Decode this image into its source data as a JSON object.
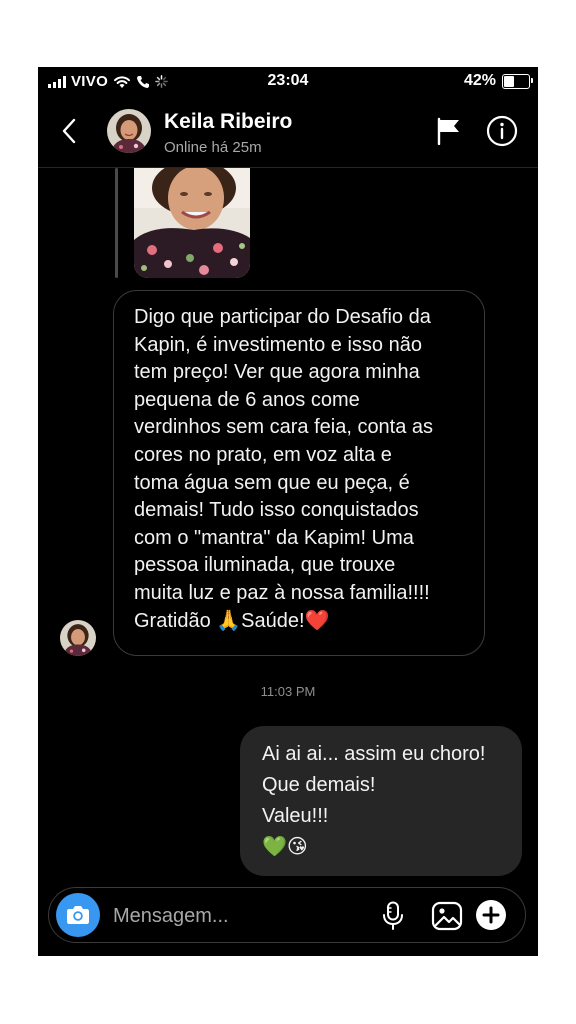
{
  "status_bar": {
    "carrier": "VIVO",
    "time": "23:04",
    "battery": "42%",
    "battery_level": 0.42
  },
  "header": {
    "contact_name": "Keila Ribeiro",
    "contact_status": "Online há 25m",
    "icons": [
      "back-icon",
      "avatar",
      "flag-icon",
      "info-icon"
    ]
  },
  "messages": {
    "received_text": "Digo que participar do Desafio da\nKapin,  é investimento e isso não\ntem preço! Ver que agora minha\npequena de 6 anos come\nverdinhos sem cara feia, conta as\ncores no prato, em voz alta e\ntoma água sem que eu peça, é\ndemais! Tudo isso conquistados\ncom o \"mantra\" da Kapim! Uma\npessoa iluminada, que trouxe\nmuita luz e paz à nossa familia!!!!\nGratidão 🙏Saúde!❤️",
    "timestamp": "11:03 PM",
    "sent_text": "Ai ai ai... assim eu choro!\nQue demais!\nValeu!!!\n💚😘"
  },
  "composer": {
    "placeholder": "Mensagem...",
    "icons": [
      "camera-icon",
      "microphone-icon",
      "gallery-icon",
      "plus-icon"
    ]
  },
  "colors": {
    "background": "#000000",
    "sent_bubble": "#262626",
    "accent_camera": "#3897f0",
    "secondary_text": "#a8a8a8"
  }
}
